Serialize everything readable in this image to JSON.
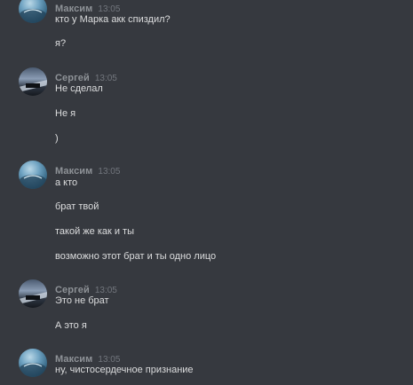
{
  "messages": [
    {
      "author": "Максим",
      "time": "13:05",
      "avatar": "maxim-avatar",
      "lines": [
        "кто у Марка акк спиздил?",
        "я?"
      ]
    },
    {
      "author": "Сергей",
      "time": "13:05",
      "avatar": "sergey-avatar",
      "lines": [
        "Не сделал",
        "Не я",
        ")"
      ]
    },
    {
      "author": "Максим",
      "time": "13:05",
      "avatar": "maxim-avatar",
      "lines": [
        "а кто",
        "брат твой",
        "такой же как и ты",
        "возможно этот брат и ты одно лицо"
      ]
    },
    {
      "author": "Сергей",
      "time": "13:05",
      "avatar": "sergey-avatar",
      "lines": [
        "Это не брат",
        "А это я"
      ]
    },
    {
      "author": "Максим",
      "time": "13:05",
      "avatar": "maxim-avatar",
      "lines": [
        "ну, чистосердечное признание"
      ]
    }
  ]
}
